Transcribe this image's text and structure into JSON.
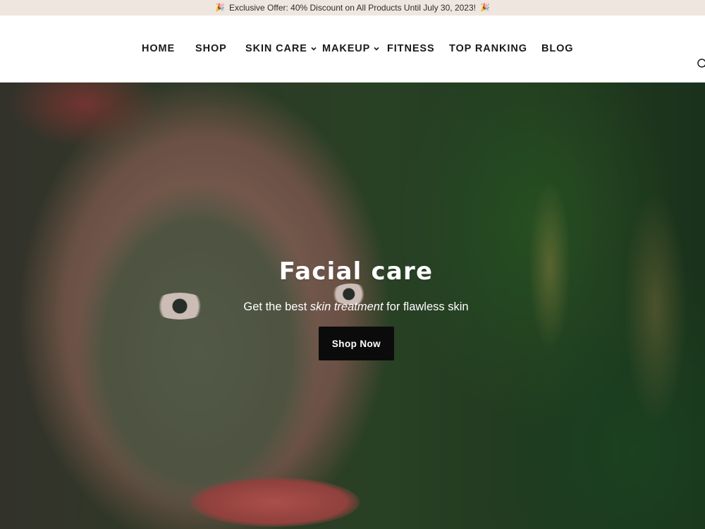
{
  "announcement": {
    "text": "Exclusive Offer: 40% Discount on All Products Until July 30, 2023!",
    "icon_left": "party-popper-icon",
    "icon_right": "party-popper-icon"
  },
  "nav": {
    "items": [
      {
        "label": "HOME",
        "has_dropdown": false
      },
      {
        "label": "SHOP",
        "has_dropdown": false
      },
      {
        "label": "SKIN CARE",
        "has_dropdown": true
      },
      {
        "label": "MAKEUP",
        "has_dropdown": true
      },
      {
        "label": "FITNESS",
        "has_dropdown": false
      },
      {
        "label": "TOP RANKING",
        "has_dropdown": false
      },
      {
        "label": "BLOG",
        "has_dropdown": false
      }
    ],
    "search_icon": "search-icon"
  },
  "hero": {
    "title": "Facial care",
    "subtitle_before": "Get the best ",
    "subtitle_emphasis": "skin treatment",
    "subtitle_after": " for flawless skin",
    "button_label": "Shop Now"
  },
  "colors": {
    "announcement_bg": "#efe6df",
    "button_bg": "#0b0b0b",
    "text_dark": "#1a1a1a"
  }
}
